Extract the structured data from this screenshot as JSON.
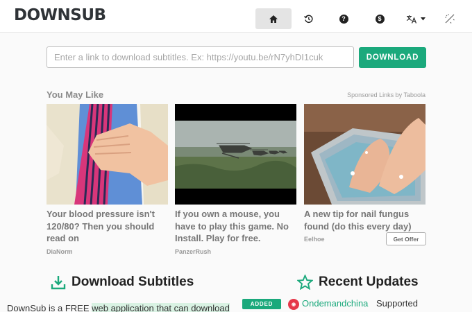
{
  "header": {
    "logo_main": "DOWNSUB",
    "nav": {
      "home_icon": "home-icon",
      "history_icon": "history-icon",
      "help_icon": "help-icon",
      "donate_icon": "dollar-icon",
      "language_icon": "translate-icon",
      "theme_icon": "theme-toggle-icon"
    }
  },
  "search": {
    "placeholder": "Enter a link to download subtitles. Ex: https://youtu.be/rN7yhDI1cuk",
    "value": "",
    "button_label": "DOWNLOAD"
  },
  "ads": {
    "heading": "You May Like",
    "sponsored": "Sponsored Links by Taboola",
    "cards": [
      {
        "title": "Your blood pressure isn't 120/80? Then you should read on",
        "source": "DiaNorm"
      },
      {
        "title": "If you own a mouse, you have to play this game. No Install. Play for free.",
        "source": "PanzerRush"
      },
      {
        "title": "A new tip for nail fungus found (do this every day)",
        "source": "Eelhoe",
        "button": "Get Offer"
      }
    ]
  },
  "sections": {
    "download_title": "Download Subtitles",
    "recent_title": "Recent Updates",
    "description_plain": "DownSub is a FREE ",
    "description_highlight": "web application that can download"
  },
  "recent": {
    "badge": "ADDED",
    "site": "Ondemandchina",
    "status": "Supported"
  },
  "colors": {
    "accent": "#1ba97c",
    "text": "#333333",
    "muted": "#8a8a8a"
  }
}
